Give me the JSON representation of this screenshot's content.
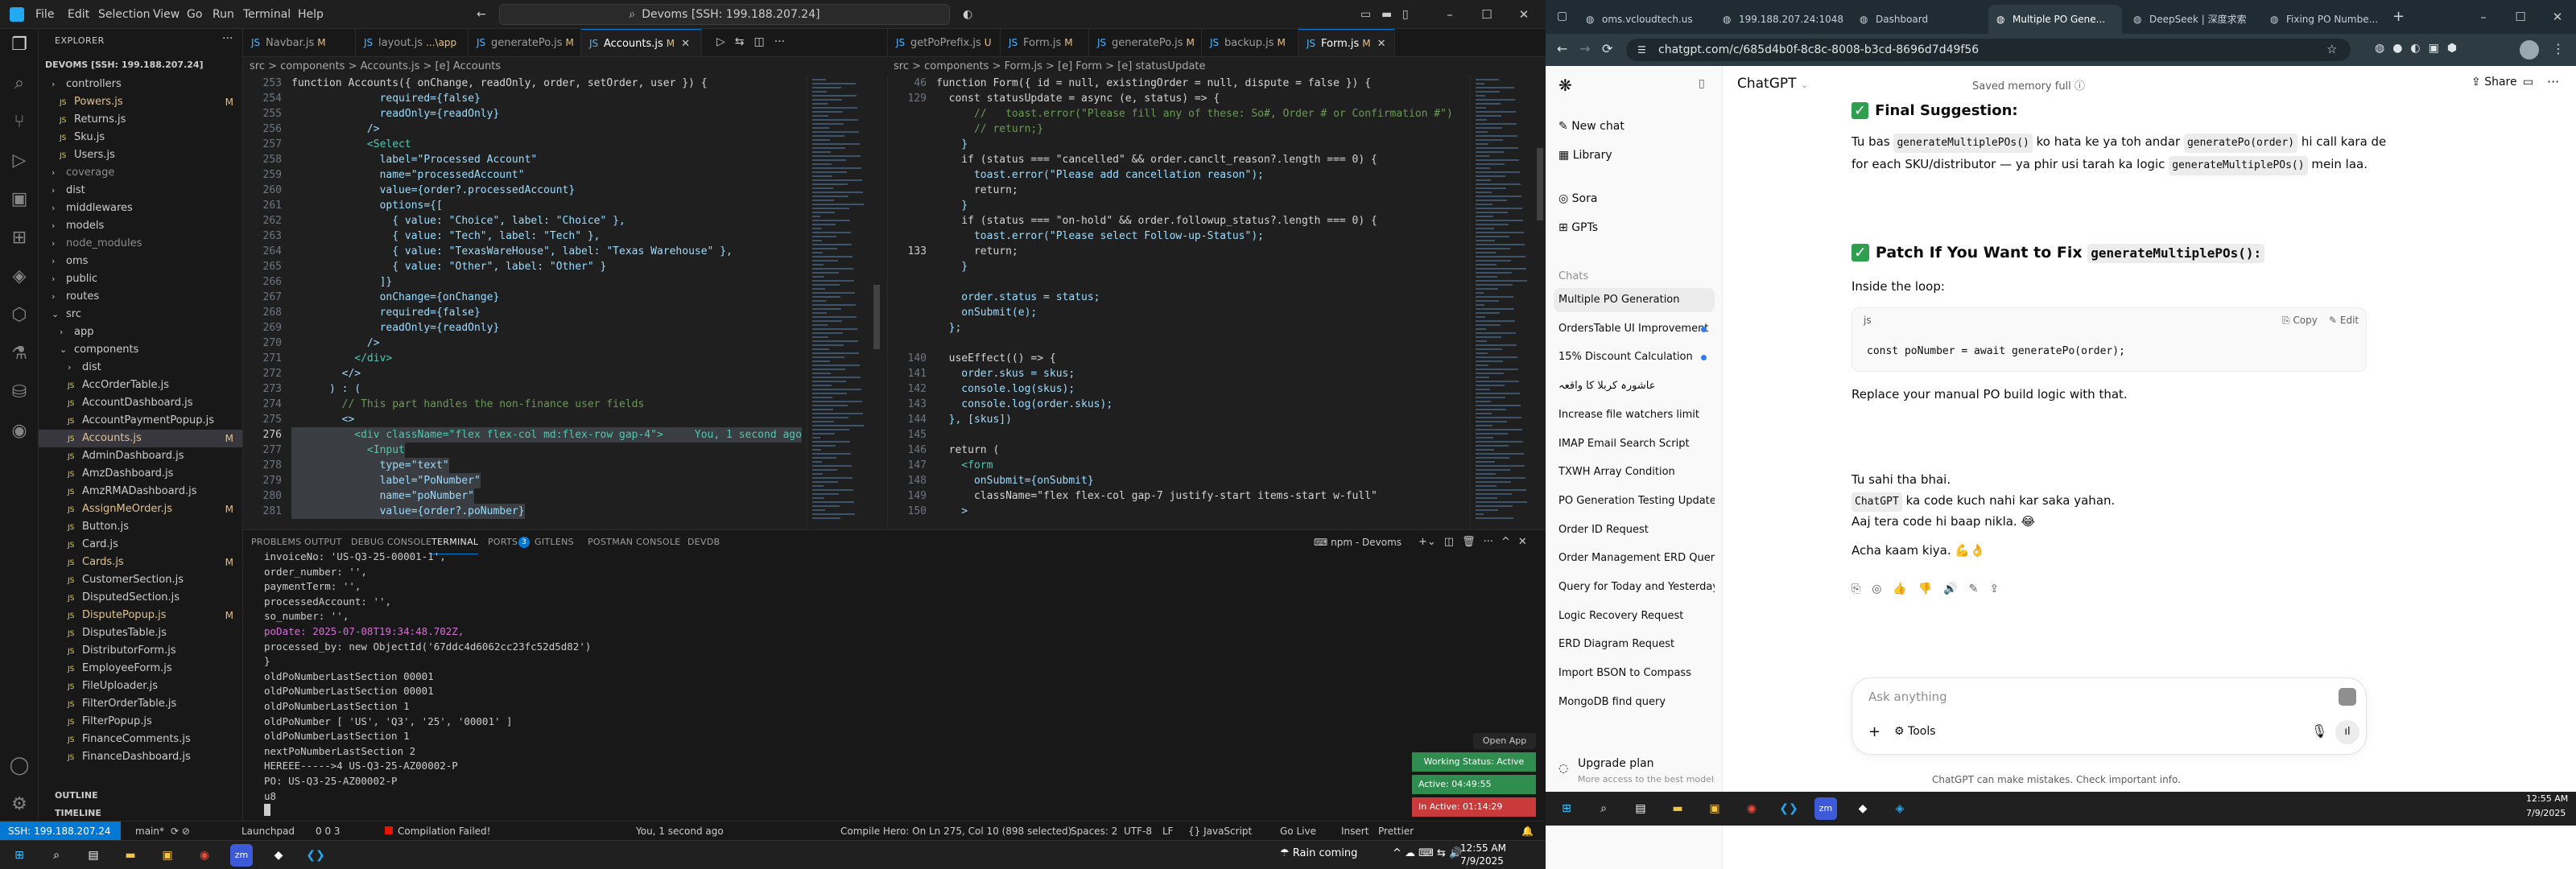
{
  "vscode": {
    "menu": [
      "File",
      "Edit",
      "Selection",
      "View",
      "Go",
      "Run",
      "Terminal",
      "Help"
    ],
    "command_center": "Devoms [SSH: 199.188.207.24]",
    "explorer_title": "EXPLORER",
    "root": "DEVOMS [SSH: 199.188.207.24]",
    "tree": [
      {
        "label": "controllers",
        "kind": "folder",
        "depth": 1,
        "mod": ""
      },
      {
        "label": "Powers.js",
        "kind": "file",
        "depth": 2,
        "mod": "M"
      },
      {
        "label": "Returns.js",
        "kind": "file",
        "depth": 2,
        "mod": ""
      },
      {
        "label": "Sku.js",
        "kind": "file",
        "depth": 2,
        "mod": ""
      },
      {
        "label": "Users.js",
        "kind": "file",
        "depth": 2,
        "mod": ""
      },
      {
        "label": "coverage",
        "kind": "folder-dim",
        "depth": 1,
        "mod": ""
      },
      {
        "label": "dist",
        "kind": "folder",
        "depth": 1,
        "mod": ""
      },
      {
        "label": "middlewares",
        "kind": "folder",
        "depth": 1,
        "mod": ""
      },
      {
        "label": "models",
        "kind": "folder",
        "depth": 1,
        "mod": ""
      },
      {
        "label": "node_modules",
        "kind": "folder-dim",
        "depth": 1,
        "mod": ""
      },
      {
        "label": "oms",
        "kind": "folder",
        "depth": 1,
        "mod": ""
      },
      {
        "label": "public",
        "kind": "folder",
        "depth": 1,
        "mod": ""
      },
      {
        "label": "routes",
        "kind": "folder",
        "depth": 1,
        "mod": ""
      },
      {
        "label": "src",
        "kind": "folder-open",
        "depth": 1,
        "mod": ""
      },
      {
        "label": "app",
        "kind": "folder",
        "depth": 2,
        "mod": ""
      },
      {
        "label": "components",
        "kind": "folder-open",
        "depth": 2,
        "mod": ""
      },
      {
        "label": "dist",
        "kind": "folder",
        "depth": 3,
        "mod": ""
      },
      {
        "label": "AccOrderTable.js",
        "kind": "file",
        "depth": 3,
        "mod": ""
      },
      {
        "label": "AccountDashboard.js",
        "kind": "file",
        "depth": 3,
        "mod": ""
      },
      {
        "label": "AccountPaymentPopup.js",
        "kind": "file",
        "depth": 3,
        "mod": ""
      },
      {
        "label": "Accounts.js",
        "kind": "file",
        "depth": 3,
        "mod": "M",
        "active": true
      },
      {
        "label": "AdminDashboard.js",
        "kind": "file",
        "depth": 3,
        "mod": ""
      },
      {
        "label": "AmzDashboard.js",
        "kind": "file",
        "depth": 3,
        "mod": ""
      },
      {
        "label": "AmzRMADashboard.js",
        "kind": "file",
        "depth": 3,
        "mod": ""
      },
      {
        "label": "AssignMeOrder.js",
        "kind": "file",
        "depth": 3,
        "mod": "M"
      },
      {
        "label": "Button.js",
        "kind": "file",
        "depth": 3,
        "mod": ""
      },
      {
        "label": "Card.js",
        "kind": "file",
        "depth": 3,
        "mod": ""
      },
      {
        "label": "Cards.js",
        "kind": "file",
        "depth": 3,
        "mod": "M"
      },
      {
        "label": "CustomerSection.js",
        "kind": "file",
        "depth": 3,
        "mod": ""
      },
      {
        "label": "DisputedSection.js",
        "kind": "file",
        "depth": 3,
        "mod": ""
      },
      {
        "label": "DisputePopup.js",
        "kind": "file",
        "depth": 3,
        "mod": "M"
      },
      {
        "label": "DisputesTable.js",
        "kind": "file",
        "depth": 3,
        "mod": ""
      },
      {
        "label": "DistributorForm.js",
        "kind": "file",
        "depth": 3,
        "mod": ""
      },
      {
        "label": "EmployeeForm.js",
        "kind": "file",
        "depth": 3,
        "mod": ""
      },
      {
        "label": "FileUploader.js",
        "kind": "file",
        "depth": 3,
        "mod": ""
      },
      {
        "label": "FilterOrderTable.js",
        "kind": "file",
        "depth": 3,
        "mod": ""
      },
      {
        "label": "FilterPopup.js",
        "kind": "file",
        "depth": 3,
        "mod": ""
      },
      {
        "label": "FinanceComments.js",
        "kind": "file",
        "depth": 3,
        "mod": ""
      },
      {
        "label": "FinanceDashboard.js",
        "kind": "file",
        "depth": 3,
        "mod": ""
      }
    ],
    "outline": "OUTLINE",
    "timeline": "TIMELINE",
    "left_tabs": [
      {
        "label": "Navbar.js",
        "mod": "M"
      },
      {
        "label": "layout.js",
        "mod": "...\\app"
      },
      {
        "label": "generatePo.js",
        "mod": "M"
      },
      {
        "label": "Accounts.js",
        "mod": "M",
        "on": true
      }
    ],
    "right_tabs": [
      {
        "label": "getPoPrefix.js",
        "mod": "U"
      },
      {
        "label": "Form.js",
        "mod": "M"
      },
      {
        "label": "generatePo.js",
        "mod": "M"
      },
      {
        "label": "backup.js",
        "mod": "M"
      },
      {
        "label": "Form.js",
        "mod": "M",
        "on": true
      }
    ],
    "left_breadcrumb": "src > components > Accounts.js > [e] Accounts",
    "right_breadcrumb": "src > components > Form.js > [e] Form > [e] statusUpdate",
    "left_code": [
      {
        "n": "253",
        "t": "function Accounts({ onChange, readOnly, order, setOrder, user }) {"
      },
      {
        "n": "254",
        "t": "              required={false}"
      },
      {
        "n": "255",
        "t": "              readOnly={readOnly}"
      },
      {
        "n": "256",
        "t": "            />"
      },
      {
        "n": "257",
        "t": "            <Select"
      },
      {
        "n": "258",
        "t": "              label=\"Processed Account\""
      },
      {
        "n": "259",
        "t": "              name=\"processedAccount\""
      },
      {
        "n": "260",
        "t": "              value={order?.processedAccount}"
      },
      {
        "n": "261",
        "t": "              options={["
      },
      {
        "n": "262",
        "t": "                { value: \"Choice\", label: \"Choice\" },"
      },
      {
        "n": "263",
        "t": "                { value: \"Tech\", label: \"Tech\" },"
      },
      {
        "n": "264",
        "t": "                { value: \"TexasWareHouse\", label: \"Texas Warehouse\" },"
      },
      {
        "n": "265",
        "t": "                { value: \"Other\", label: \"Other\" }"
      },
      {
        "n": "266",
        "t": "              ]}"
      },
      {
        "n": "267",
        "t": "              onChange={onChange}"
      },
      {
        "n": "268",
        "t": "              required={false}"
      },
      {
        "n": "269",
        "t": "              readOnly={readOnly}"
      },
      {
        "n": "270",
        "t": "            />"
      },
      {
        "n": "271",
        "t": "          </div>"
      },
      {
        "n": "272",
        "t": "        </>"
      },
      {
        "n": "273",
        "t": "      ) : ("
      },
      {
        "n": "274",
        "t": "        // This part handles the non-finance user fields"
      },
      {
        "n": "275",
        "t": "        <>"
      },
      {
        "n": "276",
        "t": "          <div className=\"flex flex-col md:flex-row gap-4\">     You, 1 second ago"
      },
      {
        "n": "277",
        "t": "            <Input"
      },
      {
        "n": "278",
        "t": "              type=\"text\""
      },
      {
        "n": "279",
        "t": "              label=\"PoNumber\""
      },
      {
        "n": "280",
        "t": "              name=\"poNumber\""
      },
      {
        "n": "281",
        "t": "              value={order?.poNumber}"
      }
    ],
    "right_code": [
      {
        "n": "46",
        "t": "function Form({ id = null, existingOrder = null, dispute = false }) {"
      },
      {
        "n": "129",
        "t": "  const statusUpdate = async (e, status) => {"
      },
      {
        "n": "",
        "t": "      //   toast.error(\"Please fill any of these: So#, Order # or Confirmation #\")"
      },
      {
        "n": "",
        "t": "      // return;}"
      },
      {
        "n": "",
        "t": "    }"
      },
      {
        "n": "",
        "t": "    if (status === \"cancelled\" && order.canclt_reason?.length === 0) {"
      },
      {
        "n": "",
        "t": "      toast.error(\"Please add cancellation reason\");"
      },
      {
        "n": "",
        "t": "      return;"
      },
      {
        "n": "",
        "t": "    }"
      },
      {
        "n": "",
        "t": "    if (status === \"on-hold\" && order.followup_status?.length === 0) {"
      },
      {
        "n": "",
        "t": "      toast.error(\"Please select Follow-up-Status\");"
      },
      {
        "n": "133",
        "t": "      return;"
      },
      {
        "n": "",
        "t": "    }"
      },
      {
        "n": "",
        "t": ""
      },
      {
        "n": "",
        "t": "    order.status = status;"
      },
      {
        "n": "",
        "t": "    onSubmit(e);"
      },
      {
        "n": "",
        "t": "  };"
      },
      {
        "n": "",
        "t": ""
      },
      {
        "n": "140",
        "t": "  useEffect(() => {"
      },
      {
        "n": "141",
        "t": "    order.skus = skus;"
      },
      {
        "n": "142",
        "t": "    console.log(skus);"
      },
      {
        "n": "143",
        "t": "    console.log(order.skus);"
      },
      {
        "n": "144",
        "t": "  }, [skus])"
      },
      {
        "n": "145",
        "t": ""
      },
      {
        "n": "146",
        "t": "  return ("
      },
      {
        "n": "147",
        "t": "    <form"
      },
      {
        "n": "148",
        "t": "      onSubmit={onSubmit}"
      },
      {
        "n": "149",
        "t": "      className=\"flex flex-col gap-7 justify-start items-start w-full\""
      },
      {
        "n": "150",
        "t": "    >"
      }
    ],
    "panel_tabs": [
      "PROBLEMS",
      "OUTPUT",
      "DEBUG CONSOLE",
      "TERMINAL",
      "PORTS",
      "GITLENS",
      "POSTMAN CONSOLE",
      "DEVDB"
    ],
    "panel_ports_badge": "3",
    "panel_right": "npm - Devoms",
    "terminal": [
      "invoiceNo: 'US-Q3-25-00001-1',",
      "order_number: '',",
      "paymentTerm: '',",
      "processedAccount: '',",
      "so_number: '',",
      "poDate: 2025-07-08T19:34:48.702Z,",
      "processed_by: new ObjectId('67ddc4d6062cc23fc52d5d82')",
      "}",
      "oldPoNumberLastSection 00001",
      "oldPoNumberLastSection 00001",
      "oldPoNumberLastSection 1",
      "oldPoNumber [ 'US', 'Q3', '25', '00001' ]",
      "oldPoNumberLastSection 1",
      "nextPoNumberLastSection 2",
      "HEREEE----->4 US-Q3-25-AZ00002-P",
      "PO: US-Q3-25-AZ00002-P",
      "u8"
    ],
    "open_app": "Open App",
    "working_status": "Working Status: Active",
    "active_time": "Active: 04:49:55",
    "inactive_time": "In Active: 01:14:29",
    "status_left": [
      "SSH: 199.188.207.24",
      "main*",
      "Launchpad",
      "0 0 3",
      "Compilation Failed!",
      "You, 1 second ago",
      "Compile Hero: On",
      "Ln 275, Col 10 (898 selected)",
      "Spaces: 2",
      "UTF-8",
      "LF",
      "{} JavaScript",
      "Go Live",
      "Insert",
      "Prettier"
    ],
    "status_right": [
      "Prettier"
    ],
    "weather": "Rain coming",
    "time": "12:55 AM",
    "date": "7/9/2025"
  },
  "chrome": {
    "tabs": [
      {
        "label": "oms.vcloudtech.us"
      },
      {
        "label": "199.188.207.24:1048"
      },
      {
        "label": "Dashboard"
      },
      {
        "label": "Multiple PO Gene...",
        "on": true
      },
      {
        "label": "DeepSeek | 深度求索"
      },
      {
        "label": "Fixing PO Numbe..."
      }
    ],
    "url": "chatgpt.com/c/685d4b0f-8c8c-8008-b3cd-8696d7d49f56",
    "sidebar": {
      "new_chat": "New chat",
      "library": "Library",
      "sora": "Sora",
      "gpts": "GPTs",
      "chats_label": "Chats",
      "chats": [
        {
          "label": "Multiple PO Generation",
          "on": true
        },
        {
          "label": "OrdersTable UI Improvement",
          "dot": true
        },
        {
          "label": "15% Discount Calculation",
          "dot": true
        },
        {
          "label": "عاشورہ کربلا کا واقعہ"
        },
        {
          "label": "Increase file watchers limit"
        },
        {
          "label": "IMAP Email Search Script"
        },
        {
          "label": "TXWH Array Condition"
        },
        {
          "label": "PO Generation Testing Update"
        },
        {
          "label": "Order ID Request"
        },
        {
          "label": "Order Management ERD Query"
        },
        {
          "label": "Query for Today and Yesterday"
        },
        {
          "label": "Logic Recovery Request"
        },
        {
          "label": "ERD Diagram Request"
        },
        {
          "label": "Import BSON to Compass"
        },
        {
          "label": "MongoDB find query"
        }
      ],
      "upgrade_title": "Upgrade plan",
      "upgrade_sub": "More access to the best models"
    },
    "header": {
      "title": "ChatGPT",
      "memory": "Saved memory full",
      "share": "Share"
    },
    "msg": {
      "final_heading": "Final Suggestion:",
      "final_line1_a": "Tu bas",
      "final_code1": "generateMultiplePOs()",
      "final_line1_b": "ko hata ke ya toh andar",
      "final_code2": "generatePo(order)",
      "final_line1_c": "hi call kara de",
      "final_line2_a": "for each SKU/distributor — ya phir usi tarah ka logic",
      "final_code3": "generateMultiplePOs()",
      "final_line2_b": "mein laa.",
      "patch_heading": "Patch If You Want to Fix",
      "patch_code": "generateMultiplePOs():",
      "inside": "Inside the loop:",
      "code_lang": "js",
      "copy": "Copy",
      "edit": "Edit",
      "code_line": "const poNumber = await generatePo(order);",
      "replace": "Replace your manual PO build logic with that.",
      "l1": "Tu sahi tha bhai.",
      "l2_code": "ChatGPT",
      "l2": "ka code kuch nahi kar saka yahan.",
      "l3": "Aaj tera code hi baap nikla. 😂",
      "l4": "Acha kaam kiya. 💪👌"
    },
    "ask_placeholder": "Ask anything",
    "tools": "Tools",
    "disclaimer": "ChatGPT can make mistakes. Check important info.",
    "time": "12:55 AM",
    "date": "7/9/2025"
  }
}
